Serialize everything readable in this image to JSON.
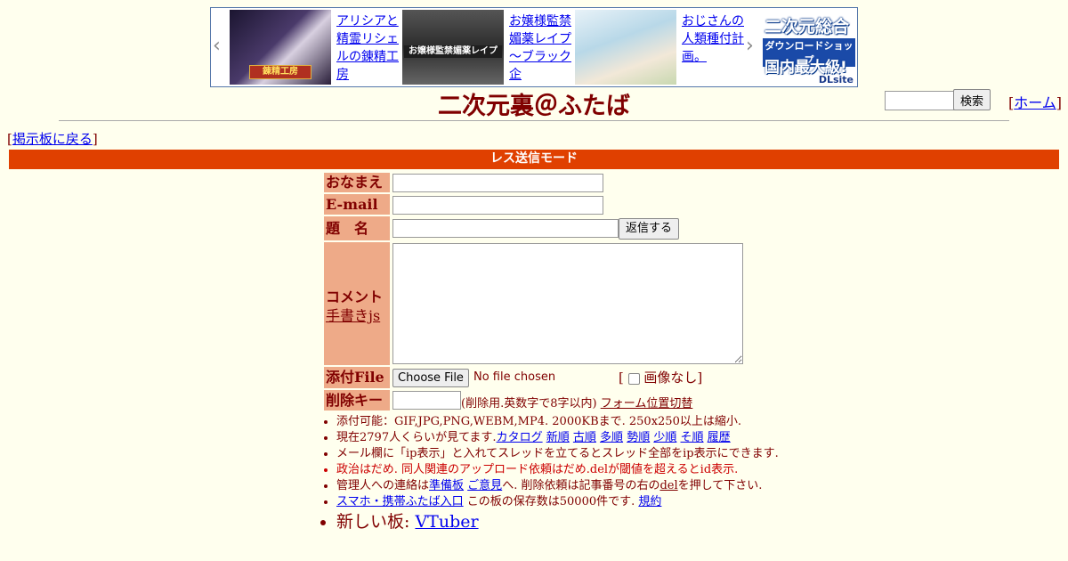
{
  "ad": {
    "items": [
      {
        "text": "アリシアと精霊リシェルの錬精工房",
        "thumb_color": "#2a2440",
        "thumb_caption": "錬精工房"
      },
      {
        "text": "お嬢様監禁媚薬レイプ～ブラック企",
        "thumb_color": "#3a3a3a",
        "thumb_caption": "お嬢様監禁媚薬レイプ"
      },
      {
        "text": "おじさんの人類種付計画。",
        "thumb_color": "#b8d8e8",
        "thumb_caption": ""
      }
    ],
    "logo_lines": [
      "二次元総合",
      "ダウンロードショップ",
      "国内最大級!",
      "DLsite"
    ]
  },
  "search": {
    "button_label": "検索",
    "value": ""
  },
  "home": {
    "label": "ホーム"
  },
  "site_title": "二次元裏＠ふたば",
  "back_link": "掲示板に戻る",
  "mode_title": "レス送信モード",
  "form": {
    "name_label": "おなまえ",
    "email_label": "E-mail",
    "subject_label": "題　名",
    "comment_label": "コメント",
    "handwriting_link": "手書きjs",
    "file_label": "添付File",
    "delkey_label": "削除キー",
    "submit_label": "返信する",
    "choose_file_label": "Choose File",
    "no_file_text": "No file chosen",
    "no_image_label": "画像なし",
    "delkey_hint": "(削除用.英数字で8字以内)",
    "form_toggle_link": "フォーム位置切替"
  },
  "notes": {
    "line1": "添付可能：GIF,JPG,PNG,WEBM,MP4. 2000KBまで. 250x250以上は縮小.",
    "line2_prefix": "現在2797人くらいが見てます.",
    "line2_links": [
      "カタログ",
      "新順",
      "古順",
      "多順",
      "勢順",
      "少順",
      "そ順",
      "履歴"
    ],
    "line3": "メール欄に「ip表示」と入れてスレッドを立てるとスレッド全部をip表示にできます.",
    "line4": "政治はだめ. 同人関連のアップロード依頼はだめ.delが閾値を超えるとid表示.",
    "line5_prefix": "管理人への連絡は",
    "line5_link1": "準備板",
    "line5_link2": "ご意見",
    "line5_mid": "へ. 削除依頼は記事番号の右の",
    "line5_del": "del",
    "line5_suffix": "を押して下さい.",
    "line6_link": "スマホ・携帯ふたば入口",
    "line6_mid": " この板の保存数は50000件です. ",
    "line6_rules": "規約",
    "line7_prefix": "新しい板: ",
    "line7_link": "VTuber"
  }
}
